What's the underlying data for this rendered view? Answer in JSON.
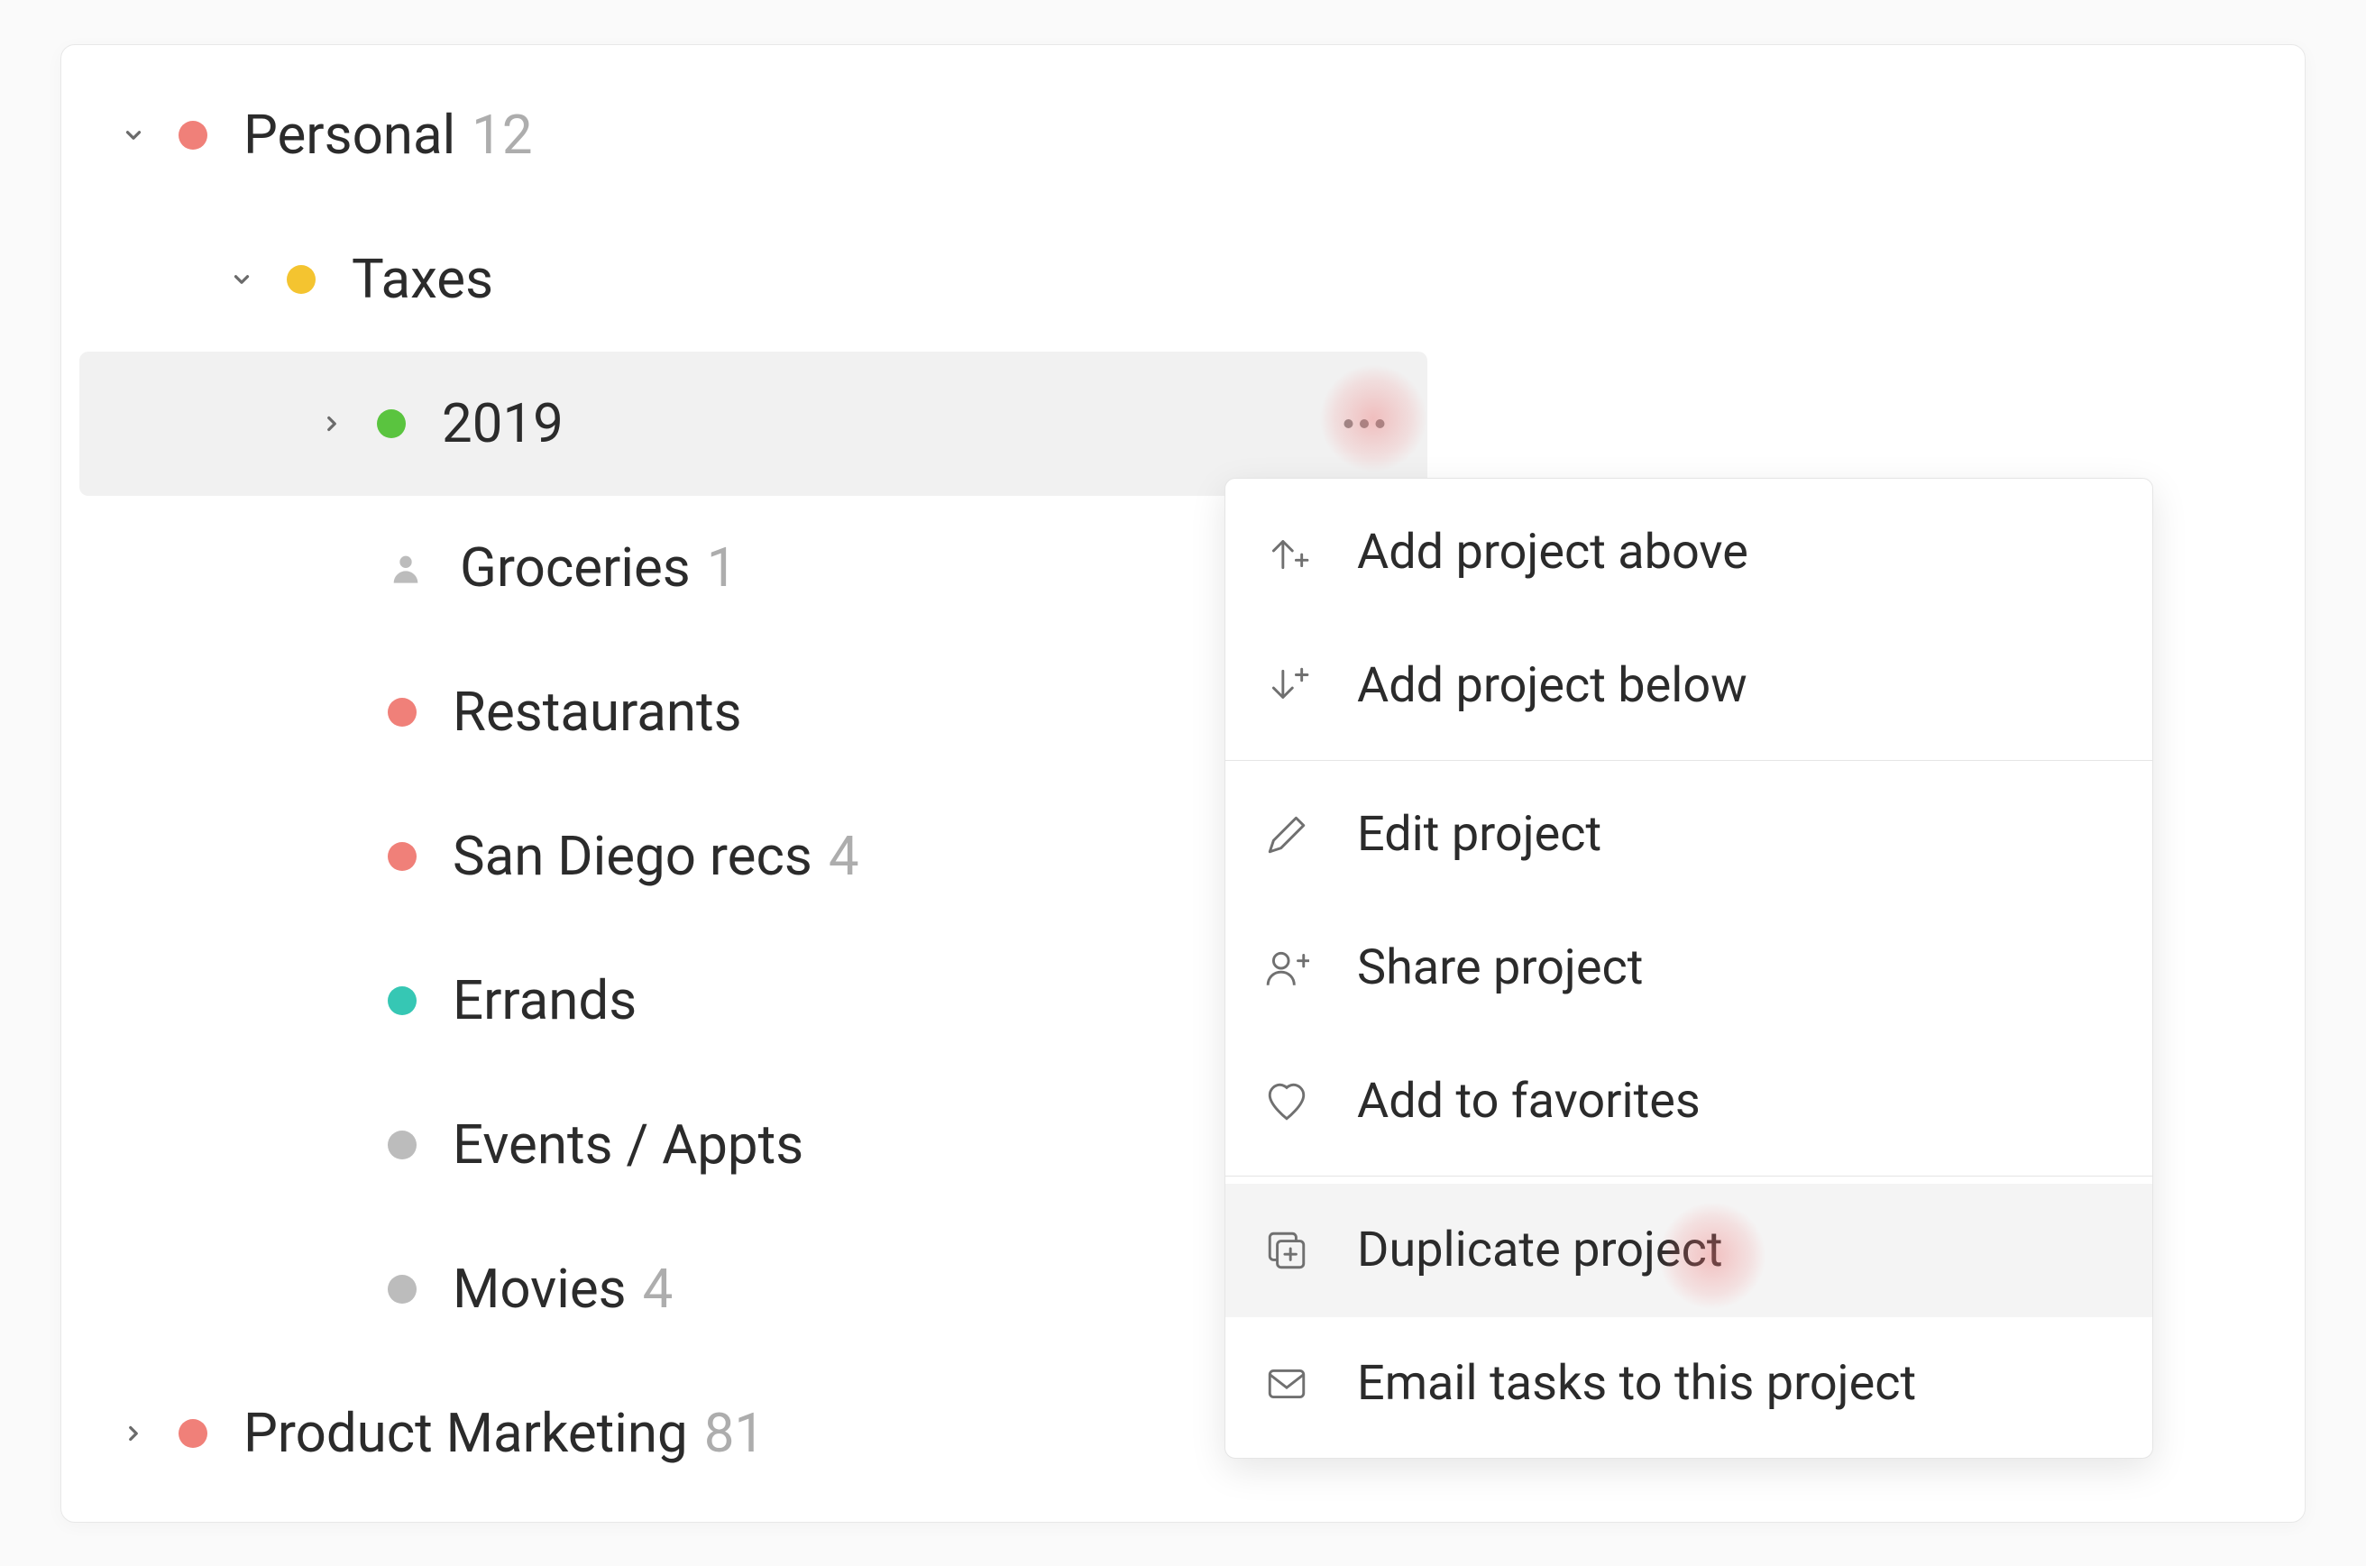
{
  "colors": {
    "salmon": "#f08079",
    "yellow": "#f4c430",
    "green": "#5ac43f",
    "gray": "#bcbcbc",
    "teal": "#36c7b4"
  },
  "sidebar": [
    {
      "indent": 0,
      "chevron": "down",
      "dot": "salmon",
      "label": "Personal",
      "count": "12"
    },
    {
      "indent": 1,
      "chevron": "down",
      "dot": "yellow",
      "label": "Taxes",
      "count": ""
    },
    {
      "indent": 2,
      "chevron": "right",
      "dot": "green",
      "label": "2019",
      "count": "",
      "selected": true,
      "more": true
    },
    {
      "indent": 2,
      "chevron": "",
      "icon": "person",
      "label": "Groceries",
      "count": "1"
    },
    {
      "indent": 2,
      "chevron": "",
      "dot": "salmon",
      "label": "Restaurants",
      "count": ""
    },
    {
      "indent": 2,
      "chevron": "",
      "dot": "salmon",
      "label": "San Diego recs",
      "count": "4"
    },
    {
      "indent": 2,
      "chevron": "",
      "dot": "teal",
      "label": "Errands",
      "count": ""
    },
    {
      "indent": 2,
      "chevron": "",
      "dot": "gray",
      "label": "Events / Appts",
      "count": ""
    },
    {
      "indent": 2,
      "chevron": "",
      "dot": "gray",
      "label": "Movies",
      "count": "4"
    },
    {
      "indent": 0,
      "chevron": "right",
      "dot": "salmon",
      "label": "Product Marketing",
      "count": "81"
    }
  ],
  "menu": {
    "groups": [
      [
        {
          "icon": "arrow-up-plus",
          "label": "Add project above"
        },
        {
          "icon": "arrow-down-plus",
          "label": "Add project below"
        }
      ],
      [
        {
          "icon": "pencil",
          "label": "Edit project"
        },
        {
          "icon": "person-plus",
          "label": "Share project"
        },
        {
          "icon": "heart",
          "label": "Add to favorites"
        }
      ],
      [
        {
          "icon": "duplicate",
          "label": "Duplicate project",
          "hover": true,
          "spot": true
        },
        {
          "icon": "envelope",
          "label": "Email tasks to this project"
        }
      ]
    ]
  }
}
